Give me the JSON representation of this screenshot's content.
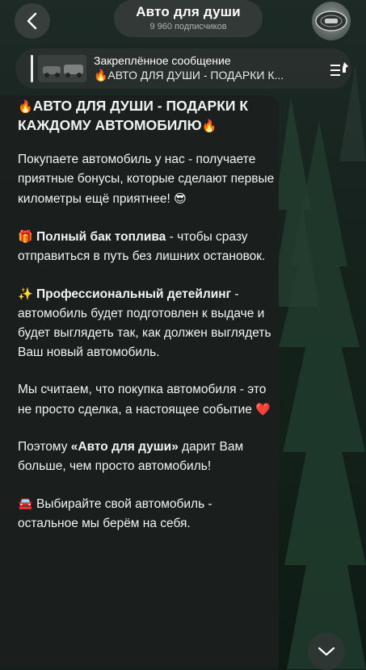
{
  "header": {
    "title": "Авто для души",
    "subtitle": "9 960 подписчиков",
    "back_icon": "chevron-left-icon",
    "avatar_icon": "channel-avatar"
  },
  "pinned": {
    "title": "Закреплённое сообщение",
    "text": "🔥АВТО ДЛЯ ДУШИ - ПОДАРКИ К...",
    "icon": "pinned-list-icon"
  },
  "message": {
    "headline_emoji_start": "🔥",
    "headline": "АВТО ДЛЯ ДУШИ - ПОДАРКИ К КАЖДОМУ АВТОМОБИЛЮ",
    "headline_emoji_end": "🔥",
    "intro": "Покупаете автомобиль у нас - получаете приятные бонусы, которые сделают первые километры ещё приятнее!",
    "intro_emoji": "😎",
    "fuel_emoji": "🎁",
    "fuel_bold": "Полный бак топлива",
    "fuel_rest": " - чтобы сразу отправиться в путь без лишних остановок.",
    "detail_emoji": "✨",
    "detail_bold": "Профессиональный детейлинг",
    "detail_rest": " - автомобиль будет подготовлен к выдаче и будет выглядеть так, как должен выглядеть Ваш новый автомобиль.",
    "event_text": "Мы считаем, что покупка автомобиля - это не просто сделка, а настоящее событие",
    "event_emoji": "❤️",
    "gift_prefix": "Поэтому ",
    "gift_bold": "«Авто для души»",
    "gift_rest": " дарит Вам больше, чем просто автомобиль!",
    "choose_emoji": "🚘",
    "choose_text": "Выбирайте свой автомобиль - остальное мы берём на себя."
  },
  "colors": {
    "bubble": "#1b1f1e",
    "text": "#f2f4f3",
    "header_pill": "#373c3a"
  }
}
